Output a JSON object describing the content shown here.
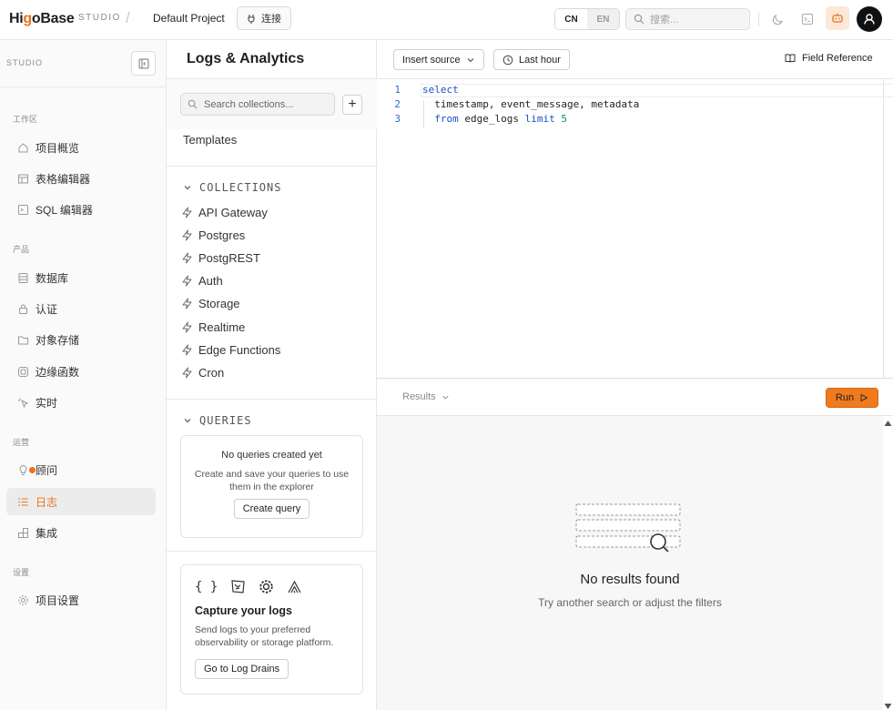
{
  "topbar": {
    "logo_prefix": "Hi",
    "logo_o": "g",
    "logo_suffix": "oBase",
    "studio": "STUDIO",
    "separator": "/",
    "project": "Default Project",
    "connect": "连接",
    "lang_cn": "CN",
    "lang_en": "EN",
    "search_placeholder": "搜索..."
  },
  "nav": {
    "header": "STUDIO",
    "sections": {
      "workspace": "工作区",
      "product": "产品",
      "ops": "运营",
      "settings": "设置"
    },
    "items": {
      "overview": "项目概览",
      "table_editor": "表格编辑器",
      "sql_editor": "SQL 编辑器",
      "database": "数据库",
      "auth": "认证",
      "storage": "对象存储",
      "edge_functions": "边缘函数",
      "realtime": "实时",
      "advisor": "顾问",
      "logs": "日志",
      "integrations": "集成",
      "project_settings": "项目设置"
    }
  },
  "collections_panel": {
    "title": "Logs & Analytics",
    "search_placeholder": "Search collections...",
    "plus": "+",
    "templates": "Templates",
    "collections_header": "COLLECTIONS",
    "collections": [
      "API Gateway",
      "Postgres",
      "PostgREST",
      "Auth",
      "Storage",
      "Realtime",
      "Edge Functions",
      "Cron"
    ],
    "queries_header": "QUERIES",
    "no_queries_title": "No queries created yet",
    "no_queries_desc": "Create and save your queries to use them in the explorer",
    "create_query": "Create query",
    "capture_title": "Capture your logs",
    "capture_desc": "Send logs to your preferred observability or storage platform.",
    "log_drains_btn": "Go to Log Drains",
    "json_icon_text": "{ }"
  },
  "editor": {
    "insert_source": "Insert source",
    "time_range": "Last hour",
    "field_reference": "Field Reference",
    "lines": [
      {
        "n": "1",
        "parts": [
          {
            "t": "select",
            "c": "kw"
          }
        ]
      },
      {
        "n": "2",
        "parts": [
          {
            "t": "  timestamp, event_message, metadata",
            "c": ""
          }
        ]
      },
      {
        "n": "3",
        "parts": [
          {
            "t": "  ",
            "c": ""
          },
          {
            "t": "from",
            "c": "kw"
          },
          {
            "t": " edge_logs ",
            "c": ""
          },
          {
            "t": "limit",
            "c": "kw"
          },
          {
            "t": " ",
            "c": ""
          },
          {
            "t": "5",
            "c": "num"
          }
        ]
      }
    ]
  },
  "results": {
    "label": "Results",
    "run": "Run",
    "empty_title": "No results found",
    "empty_sub": "Try another search or adjust the filters"
  },
  "colors": {
    "accent": "#e8731a",
    "run_bg": "#f07a1e"
  }
}
